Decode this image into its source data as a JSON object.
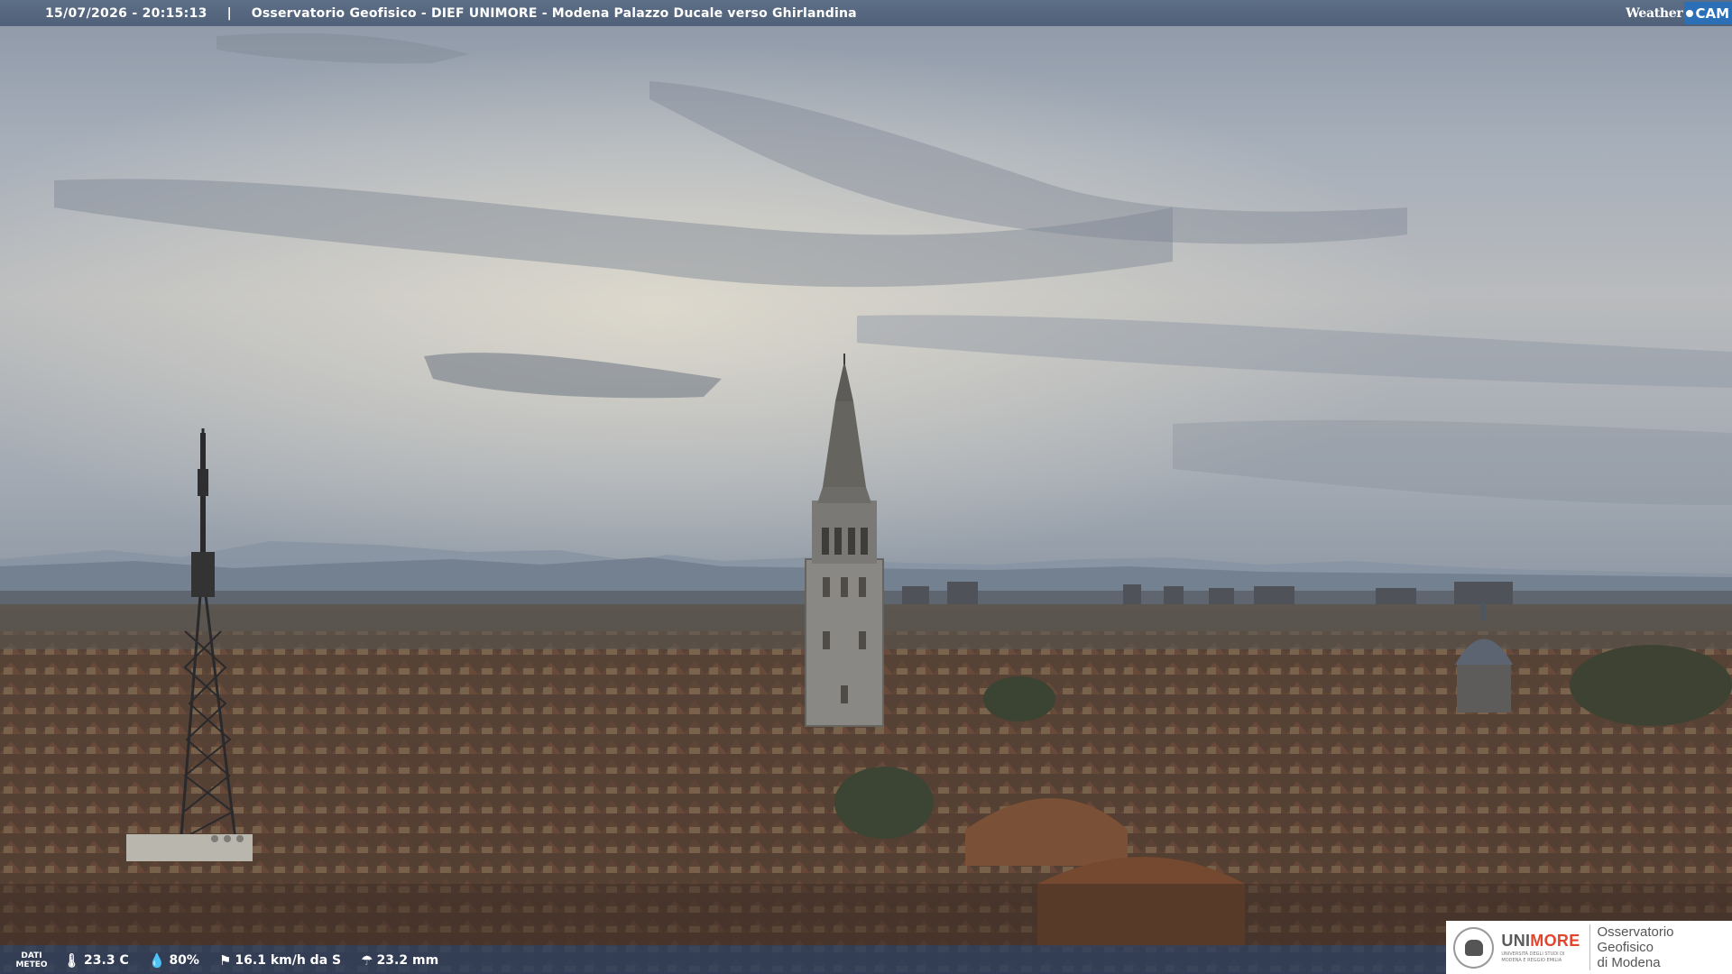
{
  "overlay": {
    "timestamp": "15/07/2026 - 20:15:13",
    "separator": "|",
    "title": "Osservatorio Geofisico - DIEF UNIMORE - Modena Palazzo Ducale verso Ghirlandina",
    "brand_word": "Weather",
    "brand_cam": "CAM"
  },
  "meteo": {
    "label_line1": "DATI",
    "label_line2": "METEO",
    "temperature": "23.3 C",
    "humidity": "80%",
    "wind": "16.1 km/h da S",
    "rain": "23.2 mm"
  },
  "logo": {
    "uni_prefix": "UNI",
    "uni_suffix": "MORE",
    "uni_sub1": "UNIVERSITÀ DEGLI STUDI DI",
    "uni_sub2": "MODENA E REGGIO EMILIA",
    "obs_line1": "Osservatorio Geofisico",
    "obs_line2": "di Modena"
  },
  "icons": [
    "thermometer-icon",
    "humidity-drop-icon",
    "wind-icon",
    "rain-icon",
    "weathercam-dot-icon",
    "unimore-seal-icon"
  ],
  "colors": {
    "topbar": "#55677f",
    "brand_blue": "#2b6fb6",
    "unimore_red": "#e2442d"
  }
}
